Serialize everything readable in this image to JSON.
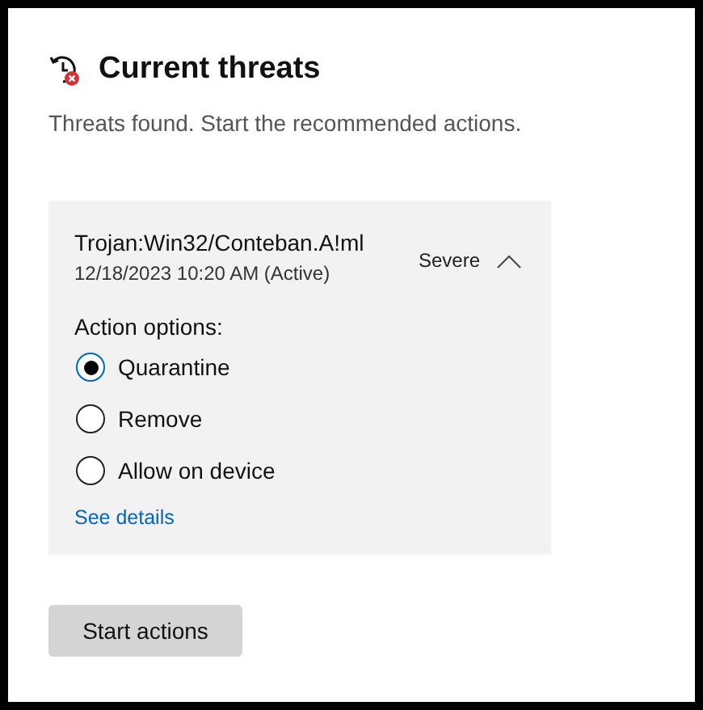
{
  "section": {
    "title": "Current threats",
    "subtitle": "Threats found. Start the recommended actions."
  },
  "threats": [
    {
      "name": "Trojan:Win32/Conteban.A!ml",
      "detected": "12/18/2023 10:20 AM (Active)",
      "severity": "Severe",
      "expanded": true,
      "options_label": "Action options:",
      "options": [
        {
          "label": "Quarantine",
          "selected": true
        },
        {
          "label": "Remove",
          "selected": false
        },
        {
          "label": "Allow on device",
          "selected": false
        }
      ],
      "details_link": "See details"
    }
  ],
  "buttons": [
    {
      "label": "Start actions"
    }
  ]
}
